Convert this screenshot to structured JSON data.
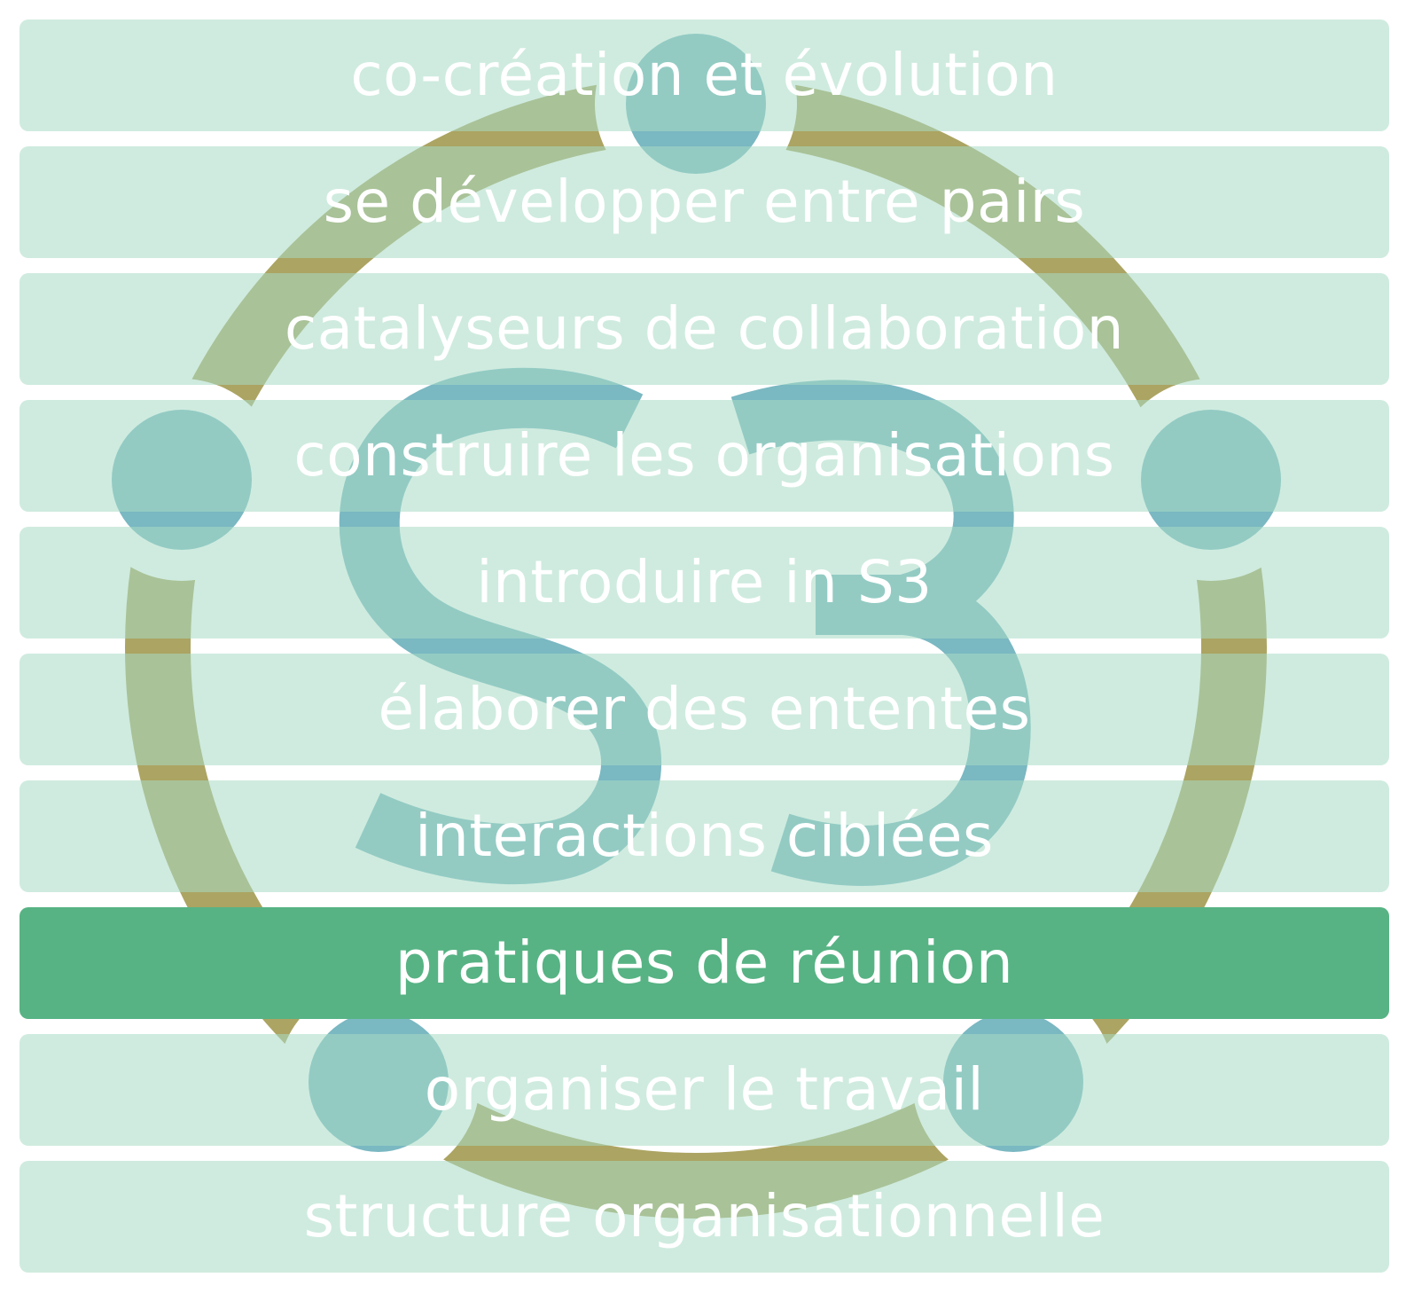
{
  "colors": {
    "band": "#a8dac4",
    "band_active": "#57b384",
    "ring": "#aca462",
    "dots": "#7ab8c2",
    "text": "#ffffff"
  },
  "logo": {
    "icon": "s3-circle-logo-icon"
  },
  "bands": [
    {
      "label": "co-création et évolution",
      "active": false
    },
    {
      "label": "se développer entre pairs",
      "active": false
    },
    {
      "label": "catalyseurs de collaboration",
      "active": false
    },
    {
      "label": "construire les organisations",
      "active": false
    },
    {
      "label": "introduire in S3",
      "active": false
    },
    {
      "label": "élaborer des ententes",
      "active": false
    },
    {
      "label": "interactions ciblées",
      "active": false
    },
    {
      "label": "pratiques de réunion",
      "active": true
    },
    {
      "label": "organiser le travail",
      "active": false
    },
    {
      "label": "structure organisationnelle",
      "active": false
    }
  ]
}
